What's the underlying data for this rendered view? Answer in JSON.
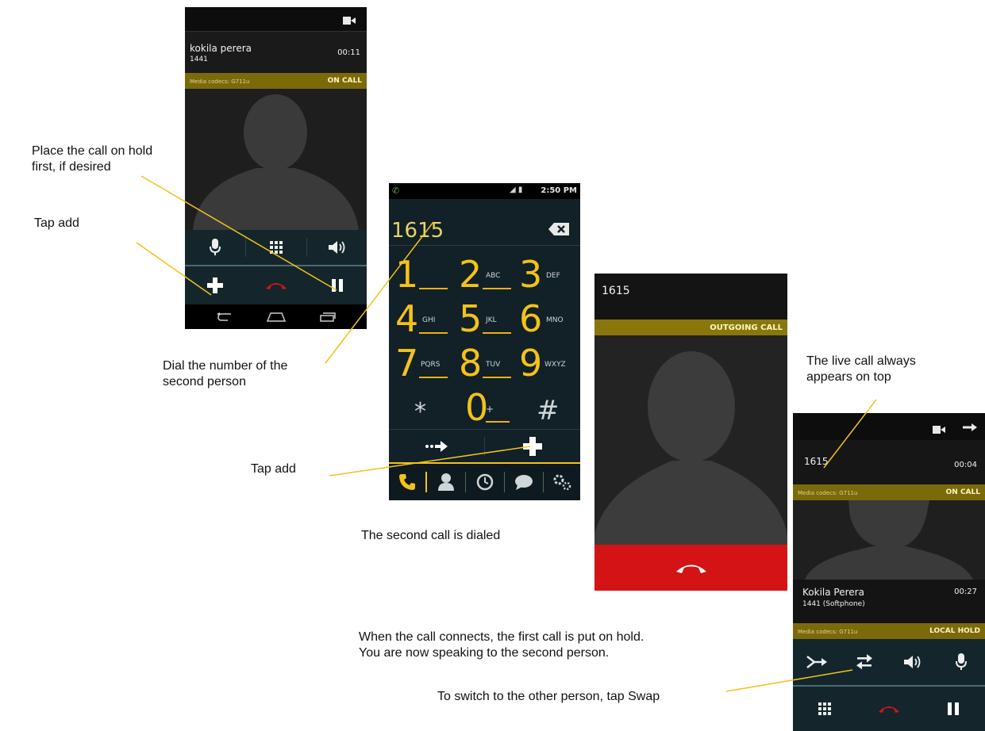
{
  "annotations": {
    "hold_first": "Place the call on hold\nfirst, if desired",
    "tap_add_1": "Tap add",
    "dial_number": "Dial the number of the\nsecond person",
    "tap_add_2": "Tap add",
    "second_dialed": "The second call is dialed",
    "live_call_top": "The live call always\nappears on top",
    "call_connects": "When the call connects, the first call is put on hold.\nYou are now speaking to the second person.",
    "switch_swap": "To switch to the other person, tap Swap"
  },
  "screen1": {
    "caller_name": "kokila perera",
    "caller_number": "1441",
    "timer": "00:11",
    "codec": "Media codecs: G711u",
    "status": "ON CALL"
  },
  "screen2": {
    "status_time": "2:50 PM",
    "dialed": "1615",
    "keys": [
      {
        "d": "1",
        "s": ""
      },
      {
        "d": "2",
        "s": "ABC"
      },
      {
        "d": "3",
        "s": "DEF"
      },
      {
        "d": "4",
        "s": "GHI"
      },
      {
        "d": "5",
        "s": "JKL"
      },
      {
        "d": "6",
        "s": "MNO"
      },
      {
        "d": "7",
        "s": "PQRS"
      },
      {
        "d": "8",
        "s": "TUV"
      },
      {
        "d": "9",
        "s": "WXYZ"
      },
      {
        "d": "*",
        "s": ""
      },
      {
        "d": "0",
        "s": "+"
      },
      {
        "d": "#",
        "s": ""
      }
    ]
  },
  "screen3": {
    "number": "1615",
    "status": "OUTGOING CALL"
  },
  "screen4": {
    "live_number": "1615",
    "live_timer": "00:04",
    "live_codec": "Media codecs: G711u",
    "live_status": "ON CALL",
    "held_name": "Kokila Perera",
    "held_number": "1441 (Softphone)",
    "held_timer": "00:27",
    "held_codec": "Media codecs: G711u",
    "held_status": "LOCAL HOLD"
  },
  "colors": {
    "accent_yellow": "#f3c21a",
    "status_band": "#7a6a0a",
    "hangup_red": "#d41414",
    "control_bar": "#14262c"
  }
}
